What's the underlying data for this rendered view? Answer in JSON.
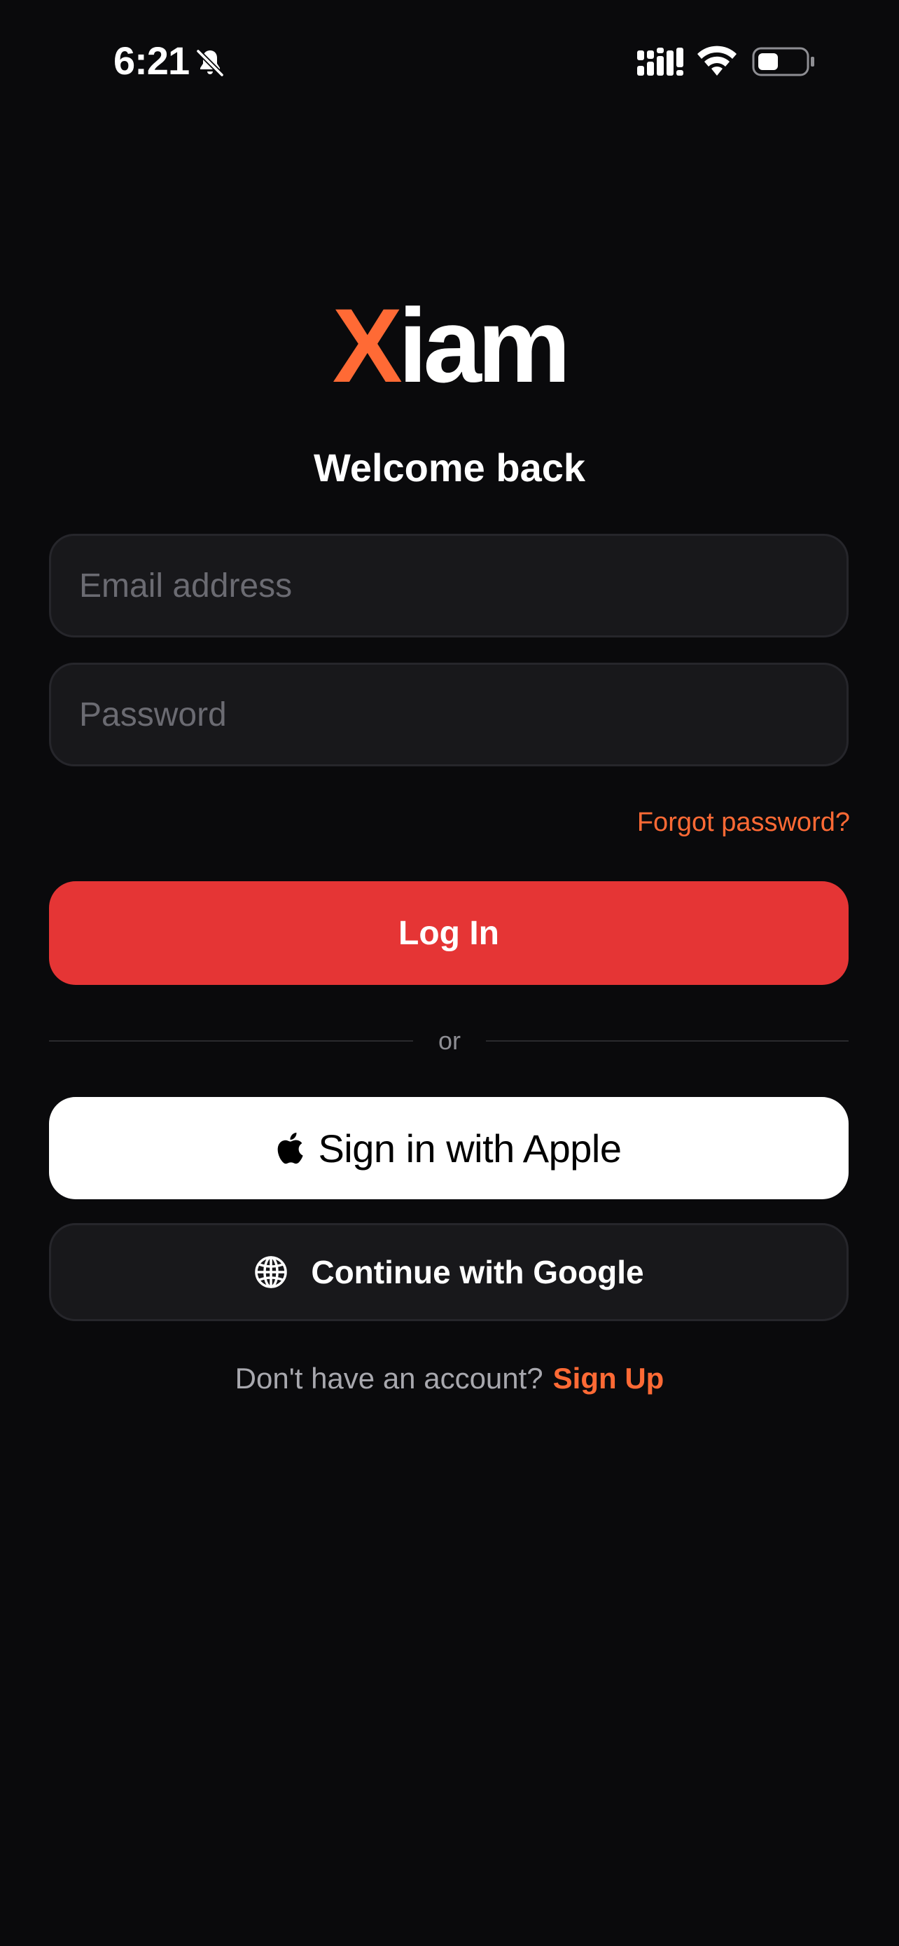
{
  "status_bar": {
    "time": "6:21",
    "icons": [
      "bell-slash-icon",
      "cellular-signal-icon",
      "wifi-icon",
      "battery-icon"
    ]
  },
  "logo": {
    "accent_letter": "X",
    "rest": "iam",
    "accent_color": "#ff6a35"
  },
  "heading": "Welcome back",
  "form": {
    "email_placeholder": "Email address",
    "email_value": "",
    "password_placeholder": "Password",
    "password_value": "",
    "forgot_label": "Forgot password?",
    "login_label": "Log In"
  },
  "divider_text": "or",
  "social": {
    "apple_label": "Sign in with Apple",
    "google_label": "Continue with Google"
  },
  "signup": {
    "prompt": "Don't have an account?",
    "link_label": "Sign Up"
  },
  "colors": {
    "background": "#0a0a0c",
    "accent": "#ff6a35",
    "primary_button": "#e53535",
    "field_background": "#18181b"
  }
}
